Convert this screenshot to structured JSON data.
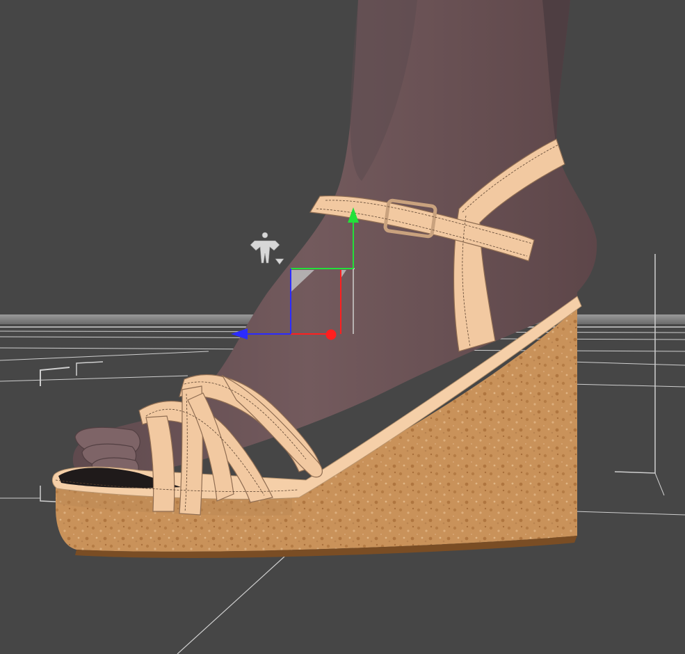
{
  "viewport": {
    "background": "#464646",
    "scene": "3d-preview",
    "selected_tool": "universal-manipulator",
    "gizmo_axes": [
      {
        "axis": "x",
        "color": "#ff1f1f"
      },
      {
        "axis": "y",
        "color": "#22e03a"
      },
      {
        "axis": "z",
        "color": "#2b2bff"
      }
    ],
    "figure_icon": "figure-pose-icon",
    "grid": true
  },
  "model": {
    "skin_color": "#6f5559",
    "strap_color": "#f2c9a1",
    "cork_color": "#c9925a"
  }
}
